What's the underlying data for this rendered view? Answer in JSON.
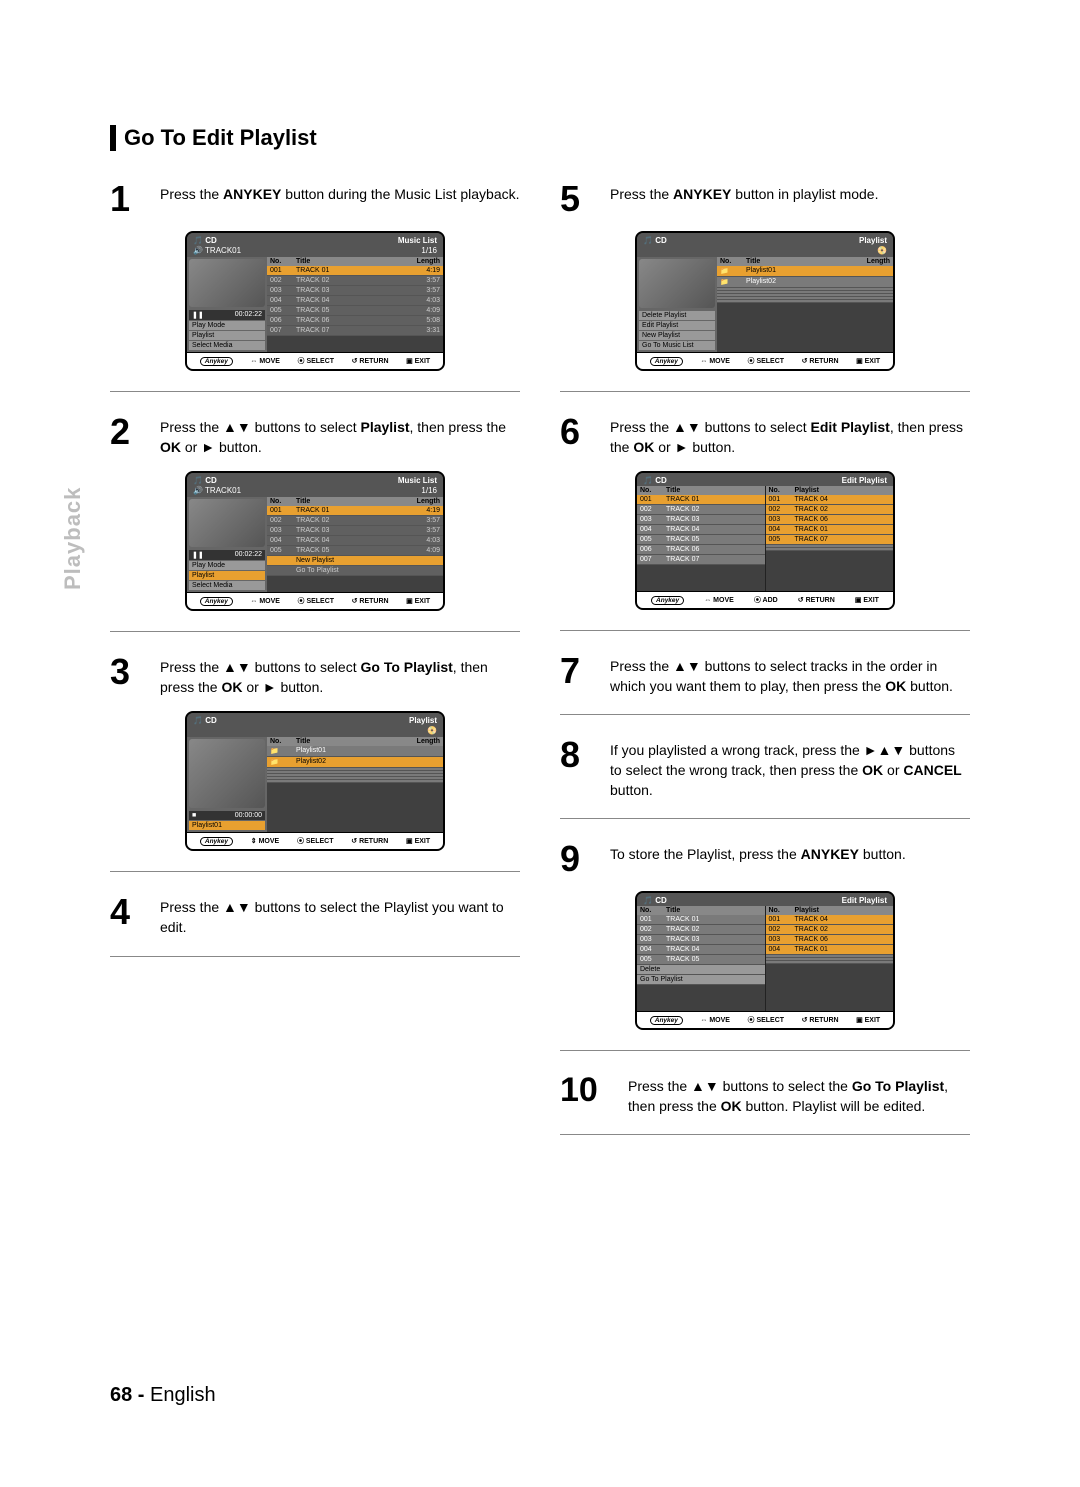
{
  "sideTab": "Playback",
  "sectionTitle": "Go To Edit Playlist",
  "footer": {
    "pageNum": "68 -",
    "lang": "English"
  },
  "icons": {
    "updown": "▲▼",
    "play": "►",
    "leftright": "►▲▼"
  },
  "steps": {
    "s1": {
      "num": "1",
      "pre": "Press the ",
      "bold": "ANYKEY",
      "post": " button during the Music List playback."
    },
    "s2": {
      "num": "2",
      "pre": "Press the ▲▼ buttons to select ",
      "bold": "Playlist",
      "post": ", then press the ",
      "bold2": "OK",
      "post2": " or ► button."
    },
    "s3": {
      "num": "3",
      "pre": "Press the ▲▼ buttons to select ",
      "bold": "Go To Playlist",
      "post": ", then press the ",
      "bold2": "OK",
      "post2": " or ► button."
    },
    "s4": {
      "num": "4",
      "text": "Press the ▲▼ buttons to select the Playlist you want to edit."
    },
    "s5": {
      "num": "5",
      "pre": "Press the ",
      "bold": "ANYKEY",
      "post": " button in playlist mode."
    },
    "s6": {
      "num": "6",
      "pre": "Press the ▲▼ buttons to select ",
      "bold": "Edit Playlist",
      "post": ", then press the ",
      "bold2": "OK",
      "post2": " or ► button."
    },
    "s7": {
      "num": "7",
      "pre": "Press the ▲▼ buttons to select tracks in the order in which you want them to play, then press the ",
      "bold": "OK",
      "post": " button."
    },
    "s8": {
      "num": "8",
      "pre": "If you playlisted a wrong track, press the ►▲▼ buttons to select the wrong track, then press the ",
      "bold": "OK",
      "mid": " or ",
      "bold2": "CANCEL",
      "post": " button."
    },
    "s9": {
      "num": "9",
      "pre": "To store the Playlist, press the ",
      "bold": "ANYKEY",
      "post": " button."
    },
    "s10": {
      "num": "10",
      "pre": "Press the ▲▼ buttons to select the ",
      "bold": "Go To Playlist",
      "post": ", then press the ",
      "bold2": "OK",
      "post2": " button. Playlist will be edited."
    }
  },
  "ui_common": {
    "cd": "CD",
    "anykey": "Anykey",
    "move": "MOVE",
    "select": "SELECT",
    "return": "RETURN",
    "exit": "EXIT",
    "add": "ADD",
    "no": "No.",
    "title": "Title",
    "length": "Length",
    "playlist": "Playlist",
    "music_list": "Music List",
    "edit_playlist": "Edit Playlist",
    "sub_1_16": "1/16",
    "track01_label": "TRACK01",
    "pause": "❚❚",
    "stop": "■",
    "time0": "00:02:22",
    "time00": "00:00:00"
  },
  "ui1": {
    "menu": [
      "Play Mode",
      "Playlist",
      "Select Media"
    ],
    "rows": [
      [
        "001",
        "TRACK 01",
        "4:19"
      ],
      [
        "002",
        "TRACK 02",
        "3:57"
      ],
      [
        "003",
        "TRACK 03",
        "3:57"
      ],
      [
        "004",
        "TRACK 04",
        "4:03"
      ],
      [
        "005",
        "TRACK 05",
        "4:09"
      ],
      [
        "006",
        "TRACK 06",
        "5:08"
      ],
      [
        "007",
        "TRACK 07",
        "3:31"
      ]
    ]
  },
  "ui2": {
    "menu": [
      "Play Mode",
      "Playlist",
      "Select Media"
    ],
    "submenu": [
      "New Playlist",
      "Go To Playlist"
    ],
    "rows": [
      [
        "001",
        "TRACK 01",
        "4:19"
      ],
      [
        "002",
        "TRACK 02",
        "3:57"
      ],
      [
        "003",
        "TRACK 03",
        "3:57"
      ],
      [
        "004",
        "TRACK 04",
        "4:03"
      ],
      [
        "005",
        "TRACK 05",
        "4:09"
      ]
    ]
  },
  "ui3": {
    "current": "Playlist01",
    "rows": [
      [
        "",
        "Playlist01",
        ""
      ],
      [
        "",
        "Playlist02",
        ""
      ]
    ]
  },
  "ui5": {
    "menu": [
      "Delete Playlist",
      "Edit Playlist",
      "New Playlist",
      "Go To Music List"
    ],
    "rows": [
      [
        "",
        "Playlist01",
        ""
      ],
      [
        "",
        "Playlist02",
        ""
      ]
    ]
  },
  "ui6": {
    "left_head": [
      "No.",
      "Title"
    ],
    "right_head": [
      "No.",
      "Playlist"
    ],
    "left": [
      [
        "001",
        "TRACK 01"
      ],
      [
        "002",
        "TRACK 02"
      ],
      [
        "003",
        "TRACK 03"
      ],
      [
        "004",
        "TRACK 04"
      ],
      [
        "005",
        "TRACK 05"
      ],
      [
        "006",
        "TRACK 06"
      ],
      [
        "007",
        "TRACK 07"
      ]
    ],
    "right": [
      [
        "001",
        "TRACK 04"
      ],
      [
        "002",
        "TRACK 02"
      ],
      [
        "003",
        "TRACK 06"
      ],
      [
        "004",
        "TRACK 01"
      ],
      [
        "005",
        "TRACK 07"
      ]
    ]
  },
  "ui9": {
    "left_head": [
      "No.",
      "Title"
    ],
    "right_head": [
      "No.",
      "Playlist"
    ],
    "left": [
      [
        "001",
        "TRACK 01"
      ],
      [
        "002",
        "TRACK 02"
      ],
      [
        "003",
        "TRACK 03"
      ],
      [
        "004",
        "TRACK 04"
      ],
      [
        "005",
        "TRACK 05"
      ],
      [
        "Delete",
        ""
      ],
      [
        "Go To Playlist",
        ""
      ]
    ],
    "right": [
      [
        "001",
        "TRACK 04"
      ],
      [
        "002",
        "TRACK 02"
      ],
      [
        "003",
        "TRACK 06"
      ],
      [
        "004",
        "TRACK 01"
      ]
    ]
  }
}
